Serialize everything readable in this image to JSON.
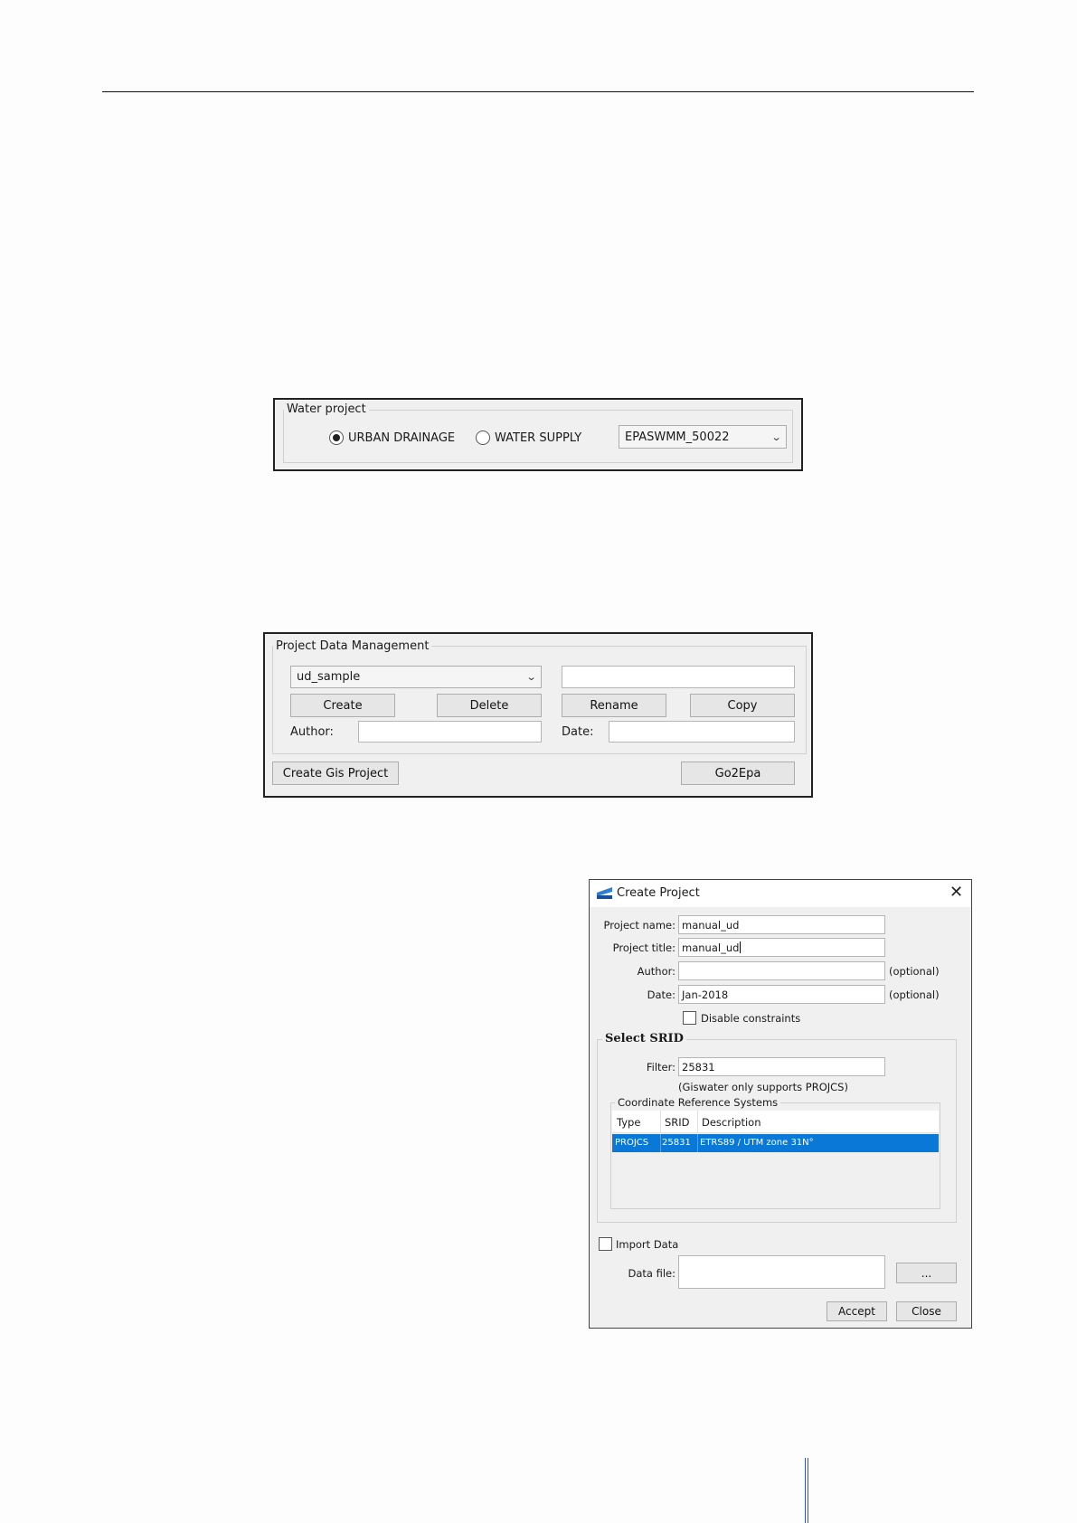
{
  "water_project": {
    "title": "Water project",
    "radio_urban": "URBAN DRAINAGE",
    "radio_supply": "WATER SUPPLY",
    "version_value": "EPASWMM_50022",
    "selected": "urban"
  },
  "project_data": {
    "title": "Project Data Management",
    "schema_value": "ud_sample",
    "rename_value": "",
    "create": "Create",
    "delete": "Delete",
    "rename": "Rename",
    "copy": "Copy",
    "author_label": "Author:",
    "author_value": "",
    "date_label": "Date:",
    "date_value": "",
    "create_gis": "Create Gis Project",
    "go2epa": "Go2Epa"
  },
  "create_dialog": {
    "title": "Create Project",
    "project_name_label": "Project name:",
    "project_name_value": "manual_ud",
    "project_title_label": "Project title:",
    "project_title_value": "manual_ud",
    "author_label": "Author:",
    "author_value": "",
    "author_optional": "(optional)",
    "date_label": "Date:",
    "date_value": "Jan-2018",
    "date_optional": "(optional)",
    "disable_constraints": "Disable constraints",
    "select_srid": "Select SRID",
    "filter_label": "Filter:",
    "filter_value": "25831",
    "projcs_note": "(Giswater only supports PROJCS)",
    "crs_group": "Coordinate Reference Systems",
    "columns": [
      "Type",
      "SRID",
      "Description"
    ],
    "rows": [
      {
        "type": "PROJCS",
        "srid": "25831",
        "description": "ETRS89 / UTM zone 31N°"
      }
    ],
    "import_data": "Import Data",
    "data_file_label": "Data file:",
    "data_file_value": "",
    "browse": "...",
    "accept": "Accept",
    "close": "Close"
  }
}
